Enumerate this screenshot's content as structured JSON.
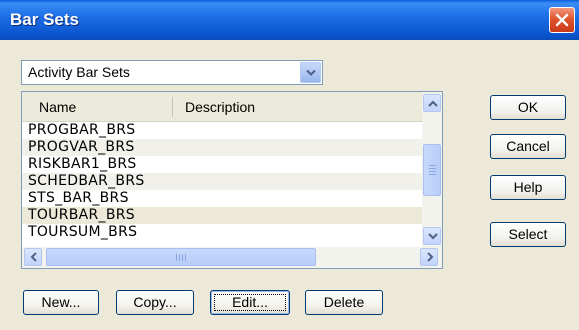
{
  "window": {
    "title": "Bar Sets"
  },
  "combo": {
    "value": "Activity Bar Sets"
  },
  "list": {
    "columns": [
      "Name",
      "Description"
    ],
    "rows": [
      {
        "name": "PROGBAR_BRS",
        "description": ""
      },
      {
        "name": "PROGVAR_BRS",
        "description": ""
      },
      {
        "name": "RISKBAR1_BRS",
        "description": ""
      },
      {
        "name": "SCHEDBAR_BRS",
        "description": ""
      },
      {
        "name": "STS_BAR_BRS",
        "description": ""
      },
      {
        "name": "TOURBAR_BRS",
        "description": ""
      },
      {
        "name": "TOURSUM_BRS",
        "description": ""
      }
    ],
    "selected_row": "TOURBAR_BRS"
  },
  "buttons": {
    "ok": "OK",
    "cancel": "Cancel",
    "help": "Help",
    "select": "Select",
    "new": "New...",
    "copy": "Copy...",
    "edit": "Edit...",
    "delete": "Delete"
  },
  "icons": {
    "close": "close-icon",
    "combo_arrow": "chevron-down-icon",
    "scroll_up": "chevron-up-icon",
    "scroll_down": "chevron-down-icon",
    "scroll_left": "chevron-left-icon",
    "scroll_right": "chevron-right-icon"
  },
  "colors": {
    "titlebar": "#0b56d0",
    "close_button": "#e0542e",
    "dialog_bg": "#ece9d8",
    "button_border": "#003c74"
  }
}
